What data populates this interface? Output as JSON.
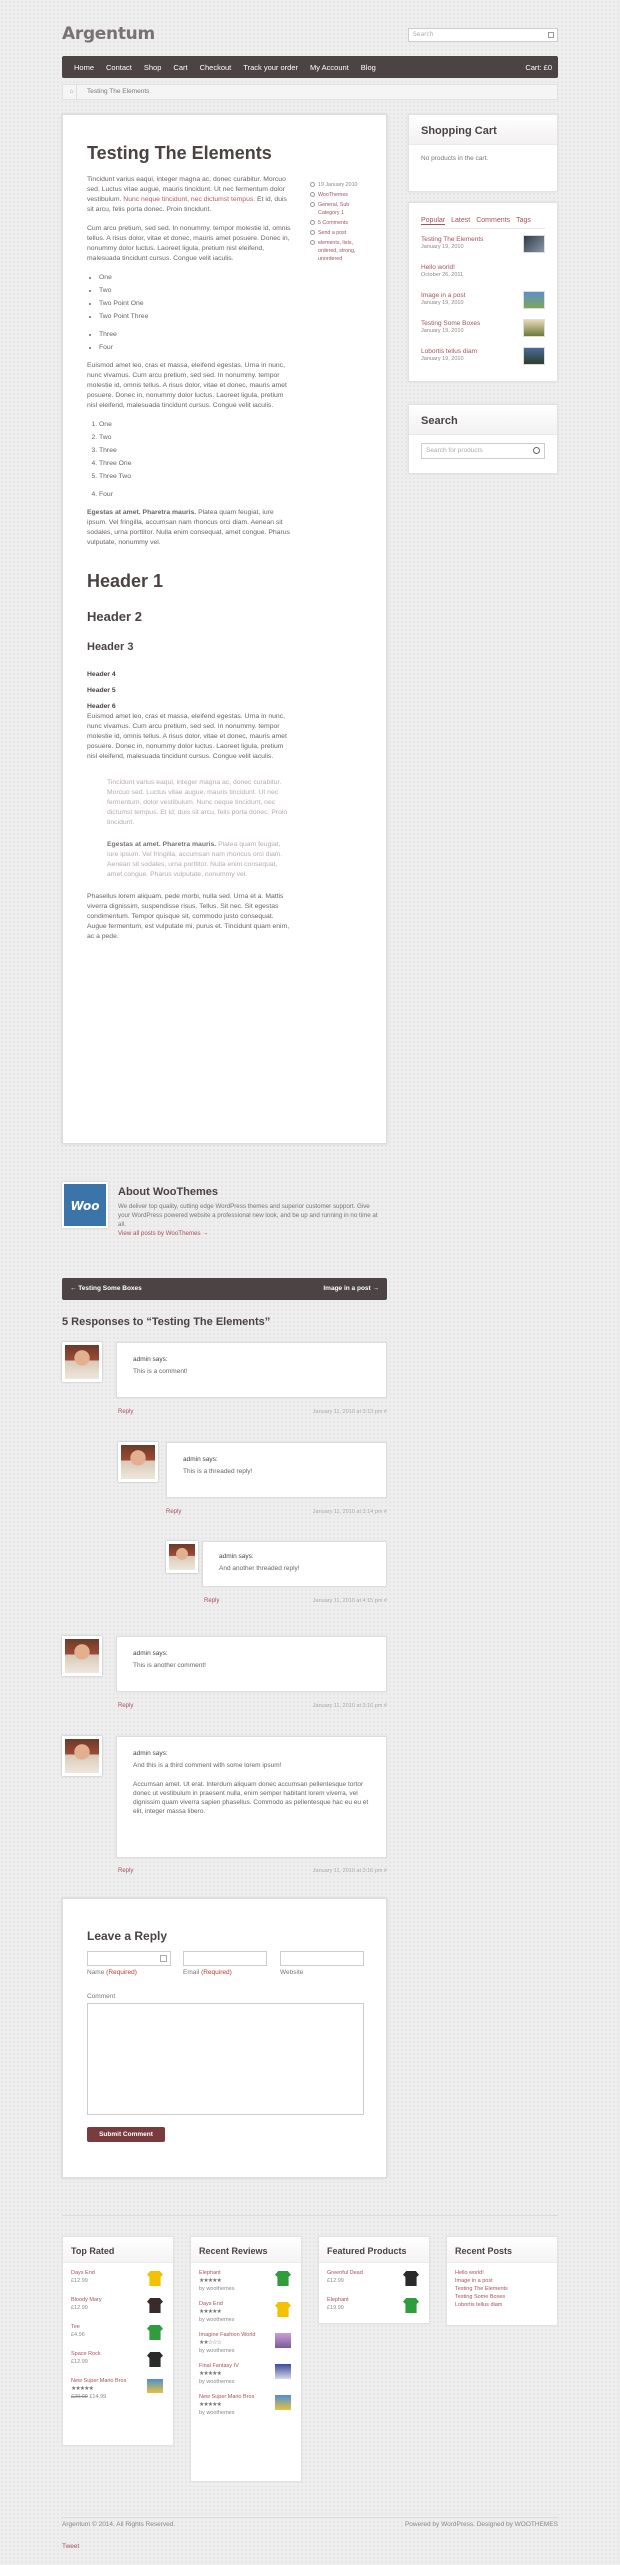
{
  "site": {
    "logo": "Argentum",
    "search_placeholder": "Search"
  },
  "nav": {
    "items": [
      "Home",
      "Contact",
      "Shop",
      "Cart",
      "Checkout",
      "Track your order",
      "My Account",
      "Blog"
    ],
    "cart": "Cart: £0"
  },
  "breadcrumb": {
    "current": "Testing The Elements"
  },
  "post": {
    "title": "Testing The Elements",
    "meta": [
      "19 January 2010",
      "WooThemes",
      "General, Sub Category 1",
      "5 Comments",
      "Send a post",
      "elements, lists, ordered, strong, unordered"
    ],
    "p1": "Tincidunt varius eaqui, integer magna ac, donec curabitur. Morcuo sed. Luctus vitae augue, mauris tincidunt. Ut nec fermentum dolor vestibulum.",
    "p1_link": "Nunc neque tincidunt, nec dictumst tempus.",
    "p1_end": "Et id, duis sit arcu, felis porta donec. Proin tincidunt.",
    "p2": "Cum arcu pretium, sed sed. In nonummy. tempor molestie id, omnis tellus. A risus dolor, vitae et donec, mauris amet posuere. Donec in, nonummy dolor luctus. Laoreet ligula, pretium nisl eleifend, malesuada tincidunt cursus. Congue velit iaculis.",
    "ul1": [
      "One",
      "Two",
      "Two Point One",
      "Two Point Three"
    ],
    "ul2": [
      "Three",
      "Four"
    ],
    "p3": "Euismod amet leo, cras et massa, eleifend egestas. Urna in nunc, nunc vivamus. Cum arcu pretium, sed sed. In nonummy. tempor molestie id, omnis tellus. A risus dolor, vitae et donec, mauris amet posuere. Donec in, nonummy dolor luctus. Laoreet ligula, pretium nisl eleifend, malesuada tincidunt cursus. Congue velit iaculis.",
    "ol1": [
      "One",
      "Two",
      "Three",
      "Three One",
      "Three Two"
    ],
    "ol2": [
      "Four"
    ],
    "p4_bold": "Egestas at amet. Pharetra mauris.",
    "p4": "Platea quam feugiat, iure ipsum. Vel fringilla, accumsan nam rhoncus orci diam. Aenean sit sodales, urna porttitor. Nulla enim consequat, amet congue. Pharus vulputate, nonummy vel.",
    "h1": "Header 1",
    "h2": "Header 2",
    "h3": "Header 3",
    "h4": "Header 4",
    "h5": "Header 5",
    "h6": "Header 6",
    "p5": "Euismod amet leo, cras et massa, eleifend egestas. Urna in nunc, nunc vivamus. Cum arcu pretium, sed sed. In nonummy. tempor molestie id, omnis tellus. A risus dolor, vitae et donec, mauris amet posuere. Donec in, nonummy dolor luctus. Laoreet ligula, pretium nisl eleifend, malesuada tincidunt cursus. Congue velit iaculis.",
    "quote1": "Tincidunt varius eaqui, integer magna ac, donec curabitur. Morcuo sed. Luctus vitae augue, mauris tincidunt. Ut nec fermentum, dolor vestibulum. Nunc neque tincidunt, nec dictumst tempus. Et id, duis sit arcu, felis porta donec. Proin tincidunt.",
    "quote2_bold": "Egestas at amet. Pharetra mauris.",
    "quote2": "Platea quam feugiat, iure ipsum. Vel fringilla, accumsan nam rhoncus orci diam. Aenean sit sodales, urna porttitor. Nulla enim consequat, amet congue. Pharus vulputate, nonummy vel.",
    "p6": "Phasellus lorem aliquam, pede morbi, nulla sed. Urna et a. Mattis viverra dignissim, suspendisse risus. Tellus. Sit nec. Sit egestas condimentum. Tempor quisque sit, commodo justo consequat. Augue fermentum, est vulputate mi, purus et. Tincidunt quam enim, ac a pede."
  },
  "sidebar": {
    "cart_title": "Shopping Cart",
    "cart_empty": "No products in the cart.",
    "tabs": [
      "Popular",
      "Latest",
      "Comments",
      "Tags"
    ],
    "posts": [
      {
        "title": "Testing The Elements",
        "date": "January 19, 2010"
      },
      {
        "title": "Hello world!",
        "date": "October 26, 2011"
      },
      {
        "title": "Image in a post",
        "date": "January 19, 2010"
      },
      {
        "title": "Testing Some Boxes",
        "date": "January 19, 2010"
      },
      {
        "title": "Lobortis tellus diam",
        "date": "January 19, 2010"
      }
    ],
    "search_title": "Search",
    "search_placeholder": "Search for products"
  },
  "author": {
    "badge": "Woo",
    "title": "About WooThemes",
    "bio": "We deliver top quality, cutting edge WordPress themes and superior customer support. Give your WordPress powered website a professional new look, and be up and running in no time at all.",
    "link": "View all posts by WooThemes →"
  },
  "postnav": {
    "prev": "← Testing Some Boxes",
    "next": "Image in a post →"
  },
  "responses_title": "5 Responses to “Testing The Elements”",
  "comments": [
    {
      "who": "admin says:",
      "text": "This is a comment!",
      "date": "January 11, 2010 at 3:13 pm #"
    },
    {
      "who": "admin says:",
      "text": "This is a threaded reply!",
      "date": "January 11, 2010 at 3:14 pm #"
    },
    {
      "who": "admin says:",
      "text": "And another threaded reply!",
      "date": "January 11, 2010 at 4:15 pm #"
    },
    {
      "who": "admin says:",
      "text": "This is another comment!",
      "date": "January 11, 2010 at 3:16 pm #"
    },
    {
      "who": "admin says:",
      "text": "And this is a third comment with some lorem ipsum!",
      "text2": "Accumsan amet. Ut erat. Interdum aliquam donec accumsan pellentesque tortor donec ut vestibulum in praesent nulla, enim semper habitant lorem viverra, vel dignissim quam viverra sapien phasellus. Commodo as pellentesque hac eu eu et elit, integer massa libero.",
      "date": "January 11, 2010 at 3:16 pm #"
    }
  ],
  "reply_label": "Reply",
  "form": {
    "title": "Leave a Reply",
    "name": "Name",
    "email": "Email",
    "website": "Website",
    "required": "(Required)",
    "comment": "Comment",
    "submit": "Submit Comment"
  },
  "footer_widgets": {
    "top_rated": {
      "title": "Top Rated",
      "items": [
        {
          "name": "Days End",
          "price": "£12.99"
        },
        {
          "name": "Bloody Mary",
          "price": "£12.99"
        },
        {
          "name": "Tee",
          "price": "£4.96"
        },
        {
          "name": "Space Rock",
          "price": "£12.99"
        },
        {
          "name": "New Super Mario Bros",
          "old": "£20.00",
          "price": "£14.99"
        }
      ]
    },
    "recent_reviews": {
      "title": "Recent Reviews",
      "items": [
        {
          "name": "Elephant",
          "by": "by woothemes"
        },
        {
          "name": "Days End",
          "by": "by woothemes"
        },
        {
          "name": "Imagine Fashion World",
          "by": "by woothemes"
        },
        {
          "name": "Final Fantasy IV",
          "by": "by woothemes"
        },
        {
          "name": "New Super Mario Bros",
          "by": "by woothemes"
        }
      ]
    },
    "featured": {
      "title": "Featured Products",
      "items": [
        {
          "name": "Greenful Dead",
          "price": "£12.99"
        },
        {
          "name": "Elephant",
          "price": "£19.99"
        }
      ]
    },
    "recent_posts": {
      "title": "Recent Posts",
      "items": [
        "Hello world!",
        "Image in a post",
        "Testing The Elements",
        "Testing Some Boxes",
        "Lobortis tellus diam"
      ]
    }
  },
  "footer": {
    "copyright": "Argentum © 2014. All Rights Reserved.",
    "credit": "Powered by WordPress. Designed by WOOTHEMES",
    "tweet": "Tweet"
  }
}
